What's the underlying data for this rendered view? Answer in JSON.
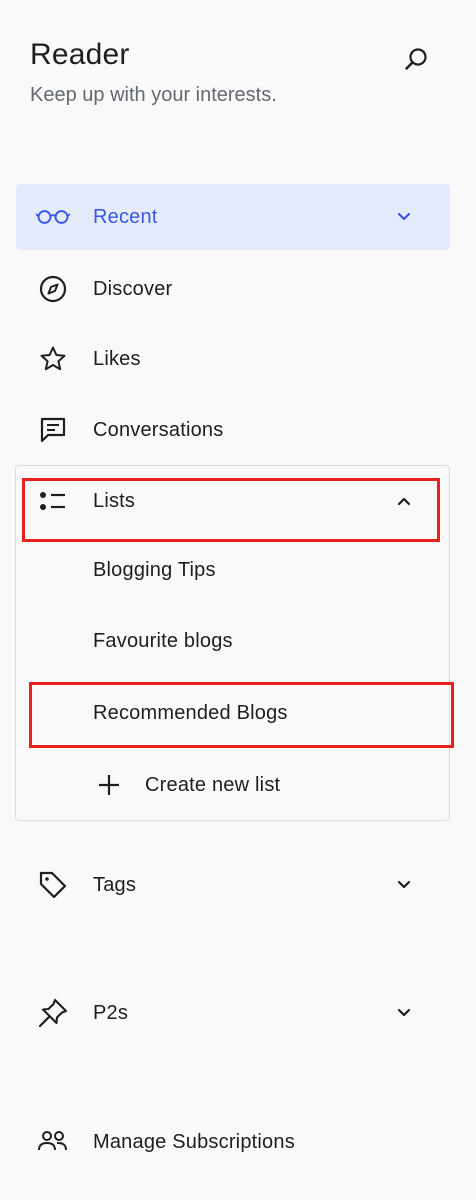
{
  "header": {
    "title": "Reader",
    "subtitle": "Keep up with your interests."
  },
  "nav": {
    "recent": "Recent",
    "discover": "Discover",
    "likes": "Likes",
    "conversations": "Conversations",
    "lists": "Lists",
    "tags": "Tags",
    "p2s": "P2s",
    "manage_subscriptions": "Manage Subscriptions"
  },
  "lists": {
    "items": [
      "Blogging Tips",
      "Favourite blogs",
      "Recommended Blogs"
    ],
    "create_label": "Create new list"
  },
  "colors": {
    "accent": "#3858e9",
    "active_bg": "#e5ebfd",
    "highlight": "#e8201e"
  },
  "icons": {
    "search": "search-icon",
    "recent": "glasses-icon",
    "discover": "compass-icon",
    "likes": "star-icon",
    "conversations": "comment-icon",
    "lists": "list-icon",
    "tags": "tag-icon",
    "p2s": "pin-icon",
    "manage_subscriptions": "people-icon"
  }
}
